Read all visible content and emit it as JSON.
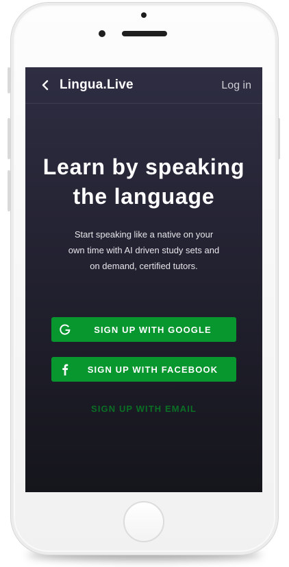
{
  "header": {
    "back_icon": "chevron-left-icon",
    "brand": "Lingua.Live",
    "login_label": "Log in"
  },
  "hero": {
    "title_line1": "Learn by speaking",
    "title_line2": "the language",
    "description_line1": "Start speaking like a native on your",
    "description_line2": "own time with AI driven study sets and",
    "description_line3": "on demand, certified tutors."
  },
  "actions": {
    "google": {
      "icon": "google-g-icon",
      "label": "SIGN UP WITH GOOGLE"
    },
    "facebook": {
      "icon": "facebook-f-icon",
      "label": "SIGN UP WITH FACEBOOK"
    },
    "email_label": "SIGN UP WITH EMAIL"
  },
  "colors": {
    "screen_bg_top": "#2e2d42",
    "screen_bg_bottom": "#15151c",
    "primary_button": "#08962f",
    "email_link": "#0a6f24",
    "text": "#ffffff"
  }
}
